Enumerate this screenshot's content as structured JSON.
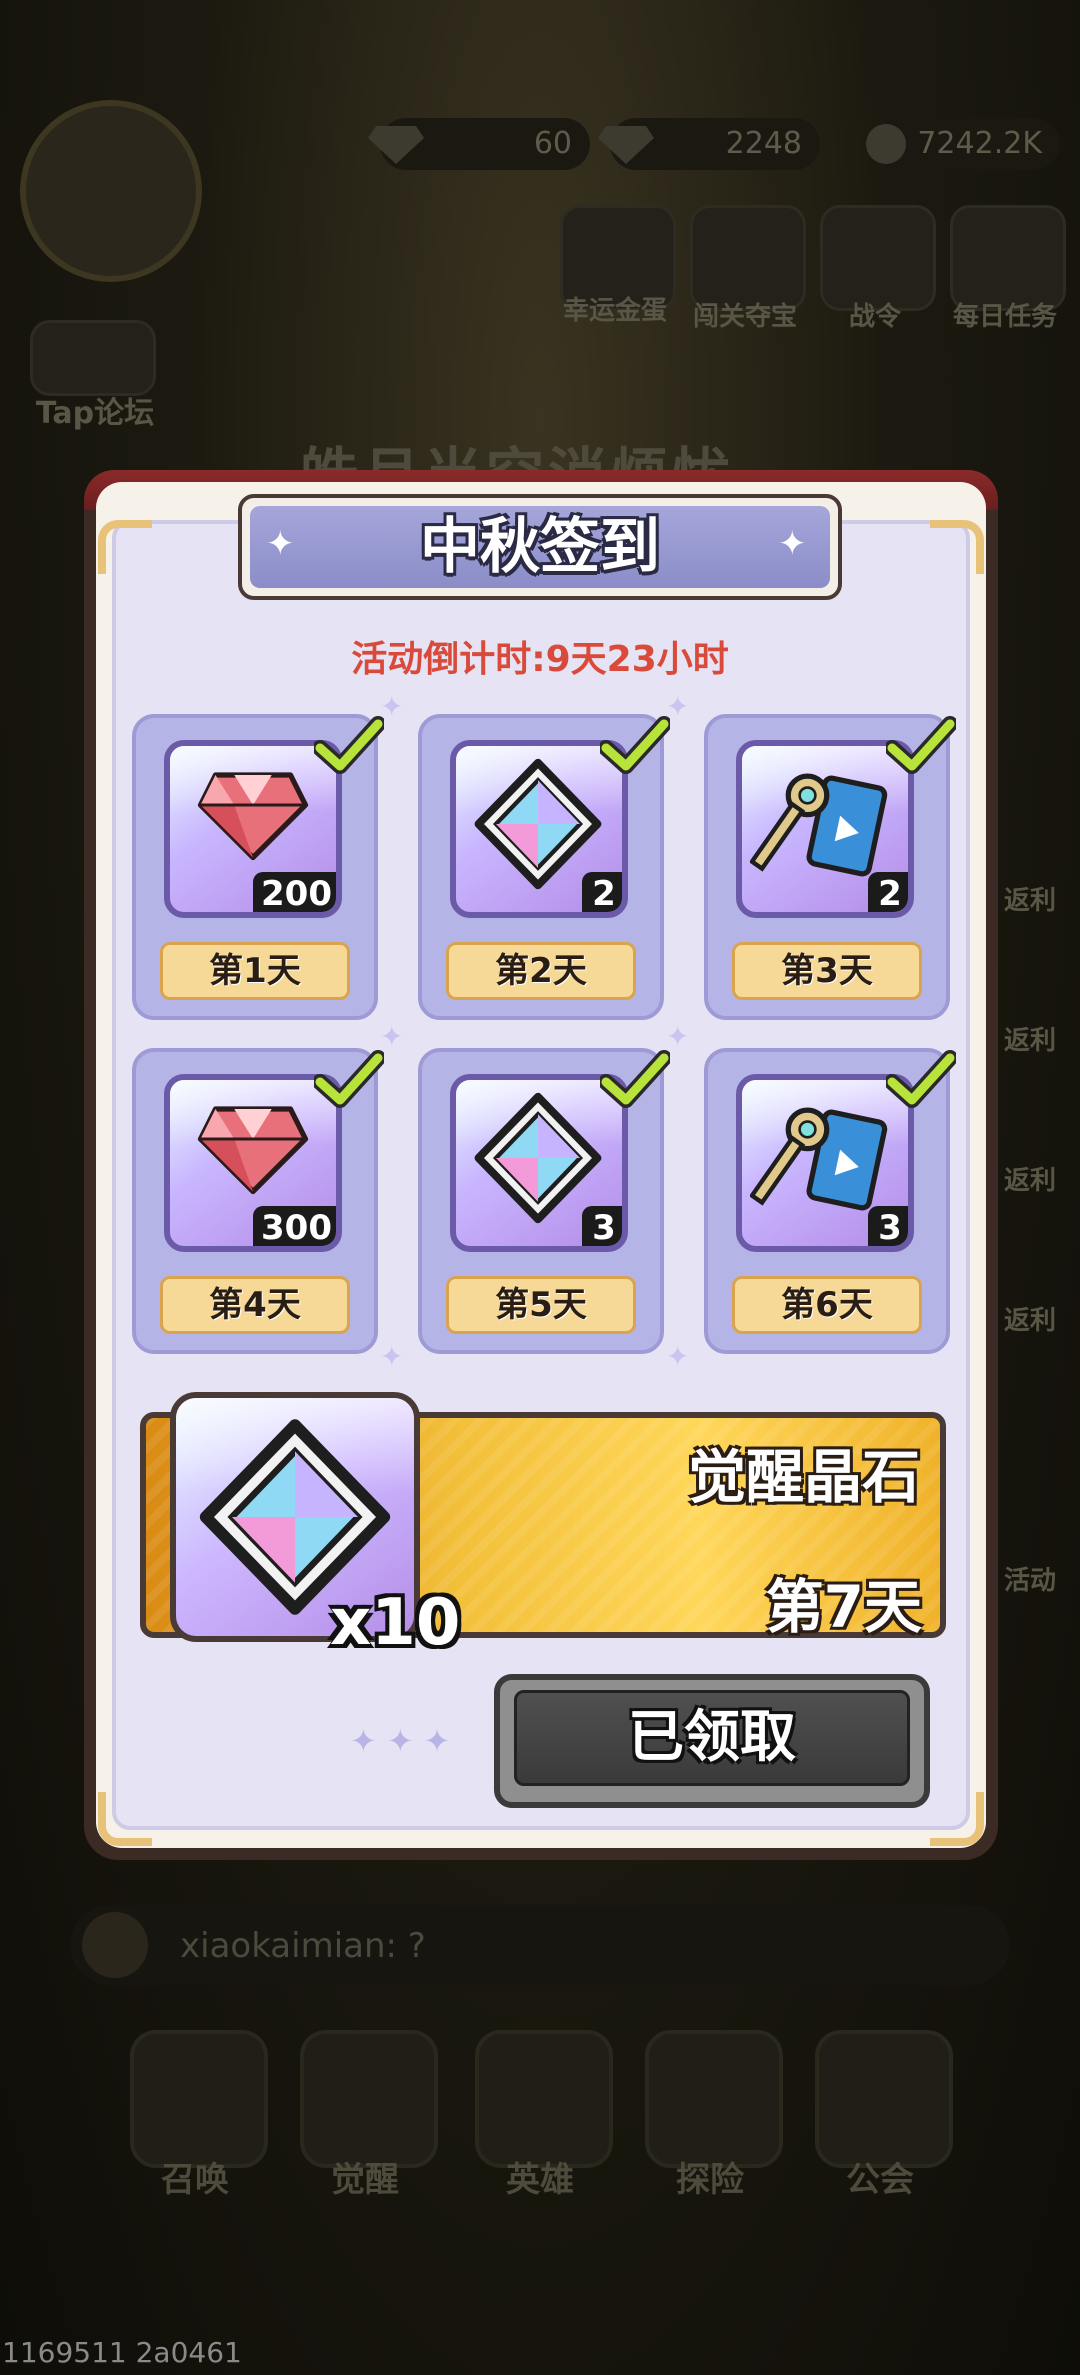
{
  "background": {
    "resources": [
      {
        "value": "60"
      },
      {
        "value": "2248"
      },
      {
        "value": "7242.2K"
      }
    ],
    "top_icons": [
      "幸运金蛋",
      "闯关夺宝",
      "战令",
      "每日任务"
    ],
    "side_labels": [
      "Tap论坛"
    ],
    "right_labels": [
      "返利",
      "返利",
      "返利",
      "返利",
      "活动"
    ],
    "title": "皓月当空消烦忧",
    "chat": {
      "user": "xiaokaimian",
      "message": "xiaokaimian: ?"
    },
    "bottom_nav": [
      "召唤",
      "觉醒",
      "英雄",
      "探险",
      "公会"
    ]
  },
  "dialog": {
    "title": "中秋签到",
    "countdown": "活动倒计时:9天23小时",
    "days": [
      {
        "label": "第1天",
        "item": "gem-icon",
        "qty": "200",
        "claimed": true
      },
      {
        "label": "第2天",
        "item": "crystal-icon",
        "qty": "2",
        "claimed": true
      },
      {
        "label": "第3天",
        "item": "key-icon",
        "qty": "2",
        "claimed": true
      },
      {
        "label": "第4天",
        "item": "gem-icon",
        "qty": "300",
        "claimed": true
      },
      {
        "label": "第5天",
        "item": "crystal-icon",
        "qty": "3",
        "claimed": true
      },
      {
        "label": "第6天",
        "item": "key-icon",
        "qty": "3",
        "claimed": true
      }
    ],
    "final_reward": {
      "name": "觉醒晶石",
      "day": "第7天",
      "qty": "x10",
      "item": "crystal-icon"
    },
    "claim_button": "已领取"
  },
  "footer_id": "1169511 2a0461",
  "colors": {
    "accent_red": "#d94a3a",
    "card_purple": "#b5b4e6",
    "day_tag": "#f6d996",
    "check_green": "#b7e33b"
  }
}
